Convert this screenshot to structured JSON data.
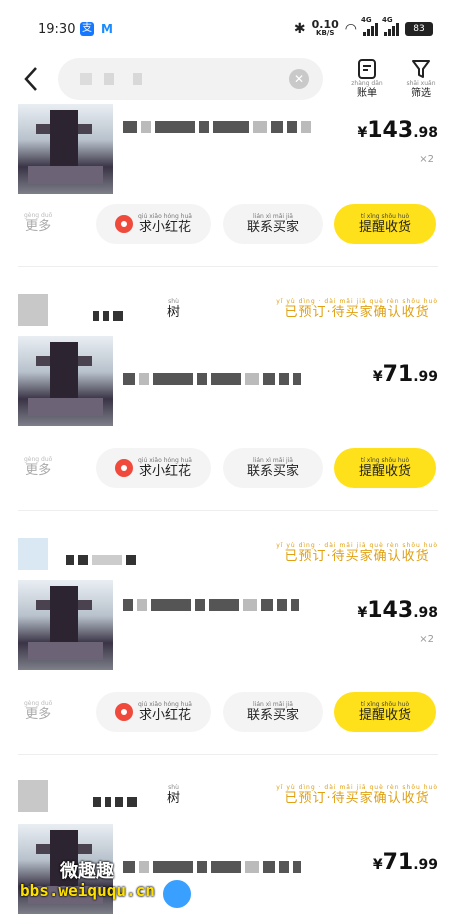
{
  "status_bar": {
    "time": "19:30",
    "app_icons": [
      "alipay-icon",
      "meituan-icon"
    ],
    "speed_value": "0.10",
    "speed_unit": "KB/S",
    "network_1": "4G",
    "network_2": "4G",
    "battery": "83"
  },
  "header": {
    "search_placeholder": "",
    "bills": {
      "pinyin": "zhàng dān",
      "label": "账单"
    },
    "filter": {
      "pinyin": "shāi xuǎn",
      "label": "筛选"
    }
  },
  "actions": {
    "more": {
      "pinyin": "gèng duō",
      "label": "更多"
    },
    "flower": {
      "pinyin": "qiú xiǎo hóng huā",
      "label": "求小红花"
    },
    "contact": {
      "pinyin": "lián xì mǎi jiā",
      "label": "联系买家"
    },
    "remind": {
      "pinyin": "tí xǐng shōu huò",
      "label": "提醒收货"
    }
  },
  "shop_suffix": {
    "pinyin": "shù",
    "label": "树"
  },
  "order_status": {
    "pinyin": "yǐ yù dìng · dài mǎi jiā què rèn shōu huò",
    "label": "已预订·待买家确认收货"
  },
  "orders": [
    {
      "price_currency": "¥",
      "price_int": "143",
      "price_dec": ".98",
      "qty": "×2",
      "show_header": false
    },
    {
      "price_currency": "¥",
      "price_int": "71",
      "price_dec": ".99",
      "qty": "",
      "show_header": true
    },
    {
      "price_currency": "¥",
      "price_int": "143",
      "price_dec": ".98",
      "qty": "×2",
      "show_header": true
    },
    {
      "price_currency": "¥",
      "price_int": "71",
      "price_dec": ".99",
      "qty": "",
      "show_header": true
    }
  ],
  "watermark": {
    "line1": "微趣趣",
    "line2": "bbs.weiququ.cn"
  },
  "colors": {
    "accent_yellow": "#ffe11b",
    "status_orange": "#e0a012"
  }
}
